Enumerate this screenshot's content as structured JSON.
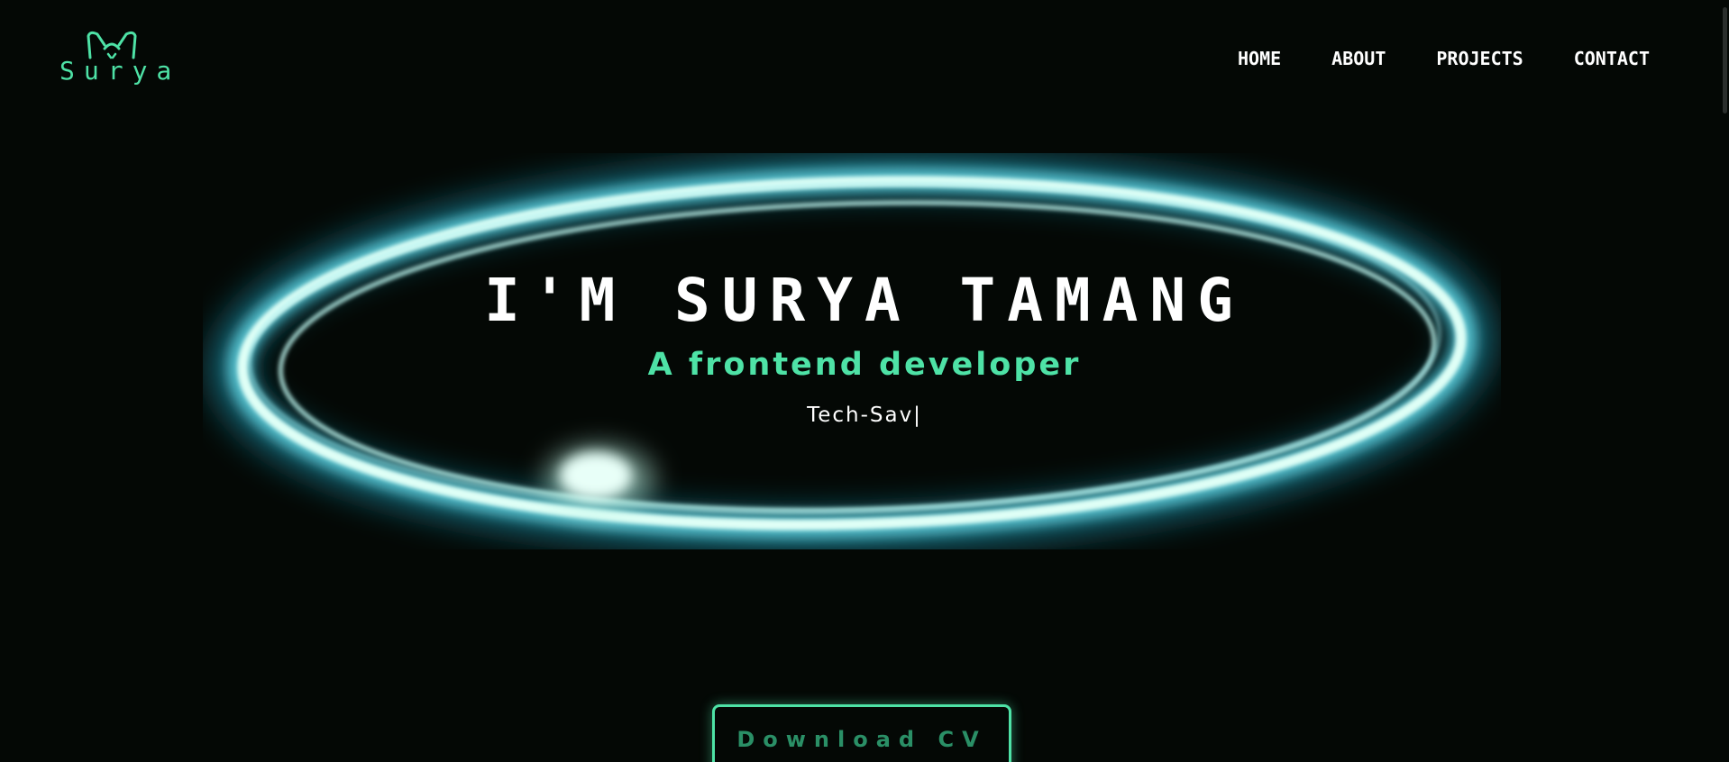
{
  "header": {
    "logo_text": "Surya",
    "logo_icon": "cat-ears-icon",
    "nav": [
      {
        "label": "HOME"
      },
      {
        "label": "ABOUT"
      },
      {
        "label": "PROJECTS"
      },
      {
        "label": "CONTACT"
      }
    ]
  },
  "hero": {
    "title": "I'M SURYA TAMANG",
    "subtitle": "A frontend developer",
    "typed_text": "Tech-Sav|",
    "ring_graphic": "glowing-ring"
  },
  "cta": {
    "download_label": "Download CV"
  },
  "colors": {
    "background": "#040805",
    "accent": "#4ee2a6",
    "ring_glow": "#1ea9c8",
    "ring_core": "#dffff6",
    "text": "#ffffff"
  }
}
